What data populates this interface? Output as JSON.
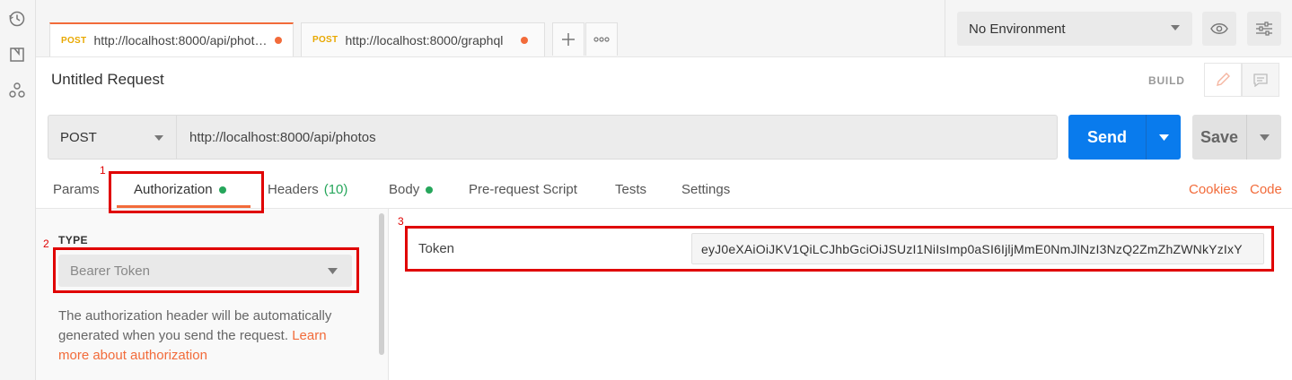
{
  "tabs": [
    {
      "method": "POST",
      "url": "http://localhost:8000/api/photo..."
    },
    {
      "method": "POST",
      "url": "http://localhost:8000/graphql"
    }
  ],
  "environment": {
    "selected": "No Environment"
  },
  "request": {
    "title": "Untitled Request",
    "build_label": "BUILD",
    "method": "POST",
    "url": "http://localhost:8000/api/photos",
    "send_label": "Send",
    "save_label": "Save"
  },
  "request_tabs": {
    "params": "Params",
    "authorization": "Authorization",
    "headers": "Headers",
    "headers_count": "(10)",
    "body": "Body",
    "prerequest": "Pre-request Script",
    "tests": "Tests",
    "settings": "Settings",
    "cookies": "Cookies",
    "code": "Code"
  },
  "auth": {
    "type_label": "TYPE",
    "type_value": "Bearer Token",
    "help_text": "The authorization header will be automatically generated when you send the request. ",
    "help_link": "Learn more about authorization",
    "token_label": "Token",
    "token_value": "eyJ0eXAiOiJKV1QiLCJhbGciOiJSUzI1NiIsImp0aSI6IjljMmE0NmJlNzI3NzQ2ZmZhZWNkYzIxY"
  },
  "annotations": [
    "1",
    "2",
    "3"
  ],
  "colors": {
    "accent": "#f26b3a",
    "send": "#097bed",
    "status_dot": "#26a65b",
    "annotation": "#e00000"
  }
}
